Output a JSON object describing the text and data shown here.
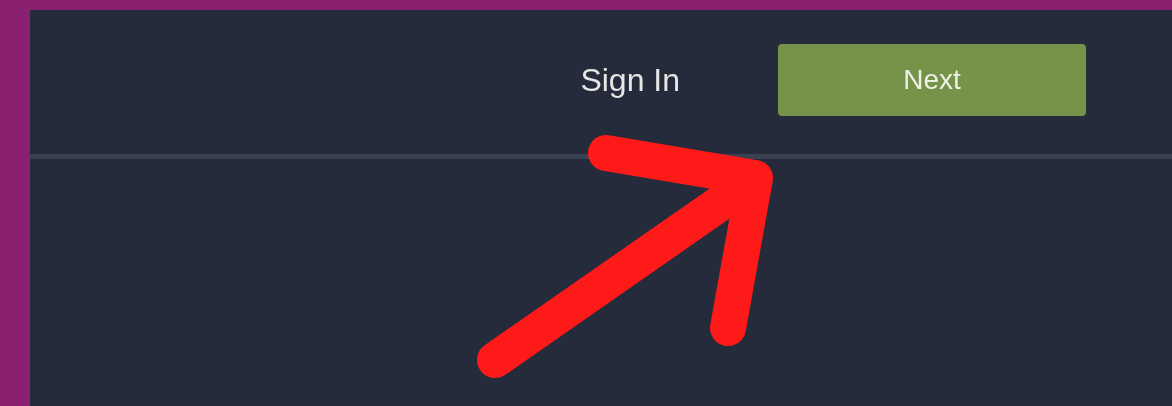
{
  "header": {
    "sign_in": "Sign In",
    "next_button": "Next"
  }
}
